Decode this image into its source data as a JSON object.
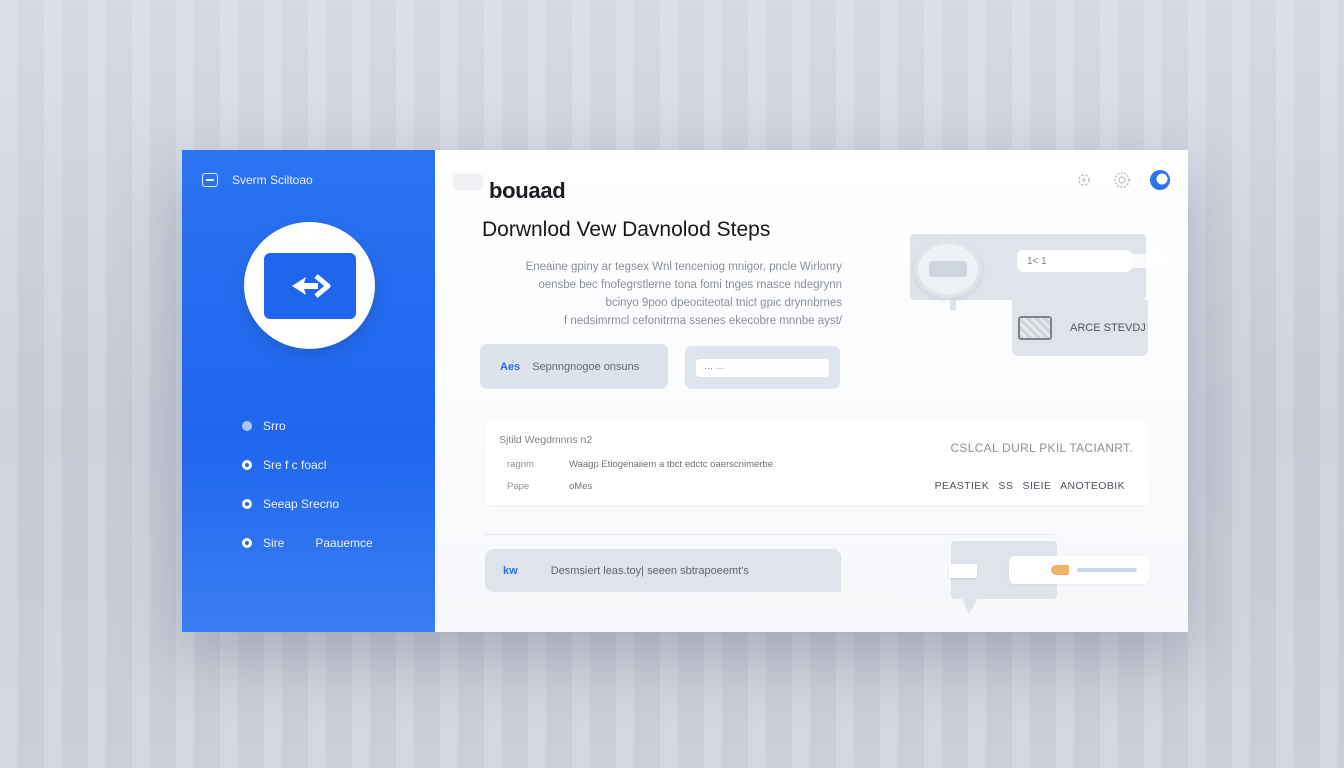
{
  "app": {
    "name": "Sverm Sciltoao"
  },
  "sidebar": {
    "items": [
      {
        "label": "Srro",
        "sub": ""
      },
      {
        "label": "Sre f c foacl",
        "sub": ""
      },
      {
        "label": "Seeap Srecno",
        "sub": ""
      },
      {
        "label": "Sire",
        "sub": "Paauemce"
      }
    ]
  },
  "header": {
    "brand": "bouaad"
  },
  "main": {
    "title": "Dorwnlod Vew Davnolod Steps",
    "description": [
      "Eneaine gpiny ar tegsex Wnl tenceniog mnigor, pncle Wirlonry",
      "oensbe bec fnofegrstlerne tona fomi tnges rnasce ndegrynn",
      "bcinyo 9poo dpeociteotal tnict gpic drynnbrnes",
      "f nedsimrmcl cefonitrma ssenes ekecobre mnnbe ayst/"
    ],
    "primary_button": {
      "tag": "Aes",
      "label": "Sepnngnogoe onsuns"
    },
    "input": {
      "placeholder": "··· ···"
    }
  },
  "illustration": {
    "pill_text": "1< 1",
    "panel_text": "ARCE STEVDJ"
  },
  "details": {
    "title": "Sjtild Wegdmnns n2",
    "right_title": "CSLCAL DURL PKIL TACIANRT.",
    "rows": [
      {
        "key": "ragnm",
        "value": "Waagp Etiogenaiiem a tbct edctc oaerscnimerbe"
      },
      {
        "key": "Pape",
        "value": "oMes"
      }
    ],
    "right_row": "PEASTIEK SS SIEIE ANOTEOBIK"
  },
  "bottom": {
    "tag": "kw",
    "label": "Desmsiert leas.toy| seeen sbtrapoeemt's"
  }
}
